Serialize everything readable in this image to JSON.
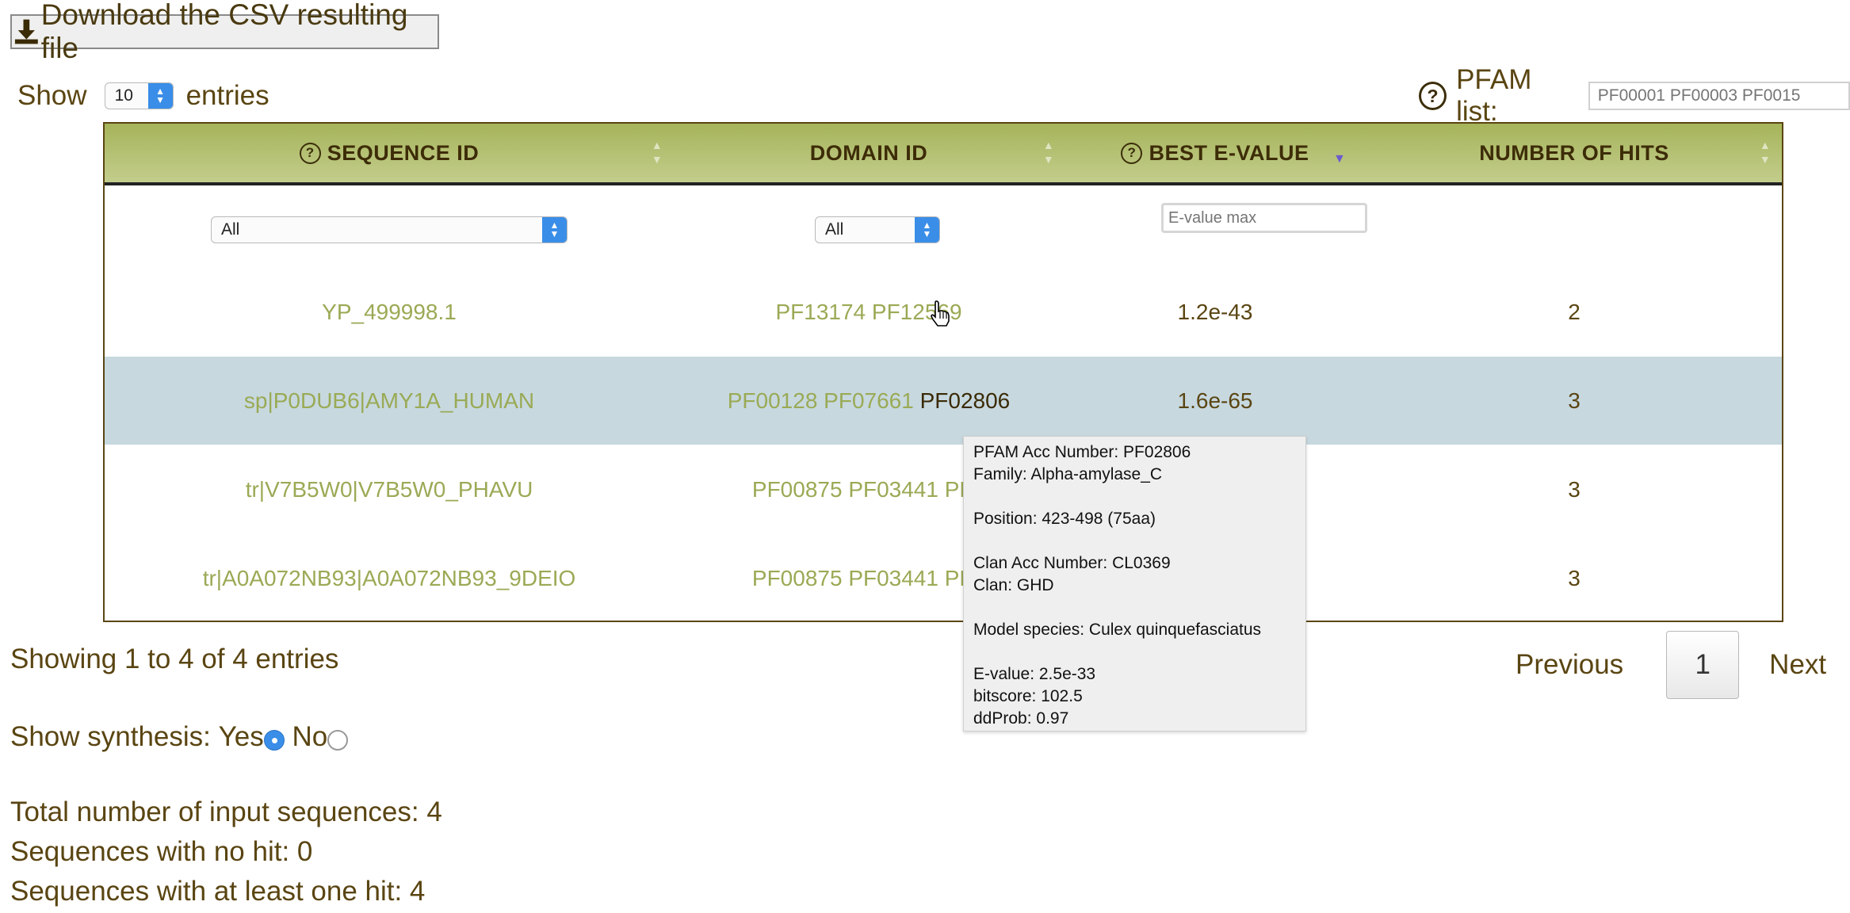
{
  "toolbar": {
    "download_label": "Download the CSV resulting file"
  },
  "length_menu": {
    "show_label": "Show",
    "value": "10",
    "entries_label": "entries"
  },
  "pfam_filter": {
    "label": "PFAM list:",
    "placeholder": "PF00001 PF00003 PF0015"
  },
  "table": {
    "columns": [
      {
        "label": "SEQUENCE ID",
        "help": "?"
      },
      {
        "label": "DOMAIN ID"
      },
      {
        "label": "BEST E-VALUE",
        "help": "?",
        "sort": "descending"
      },
      {
        "label": "NUMBER OF HITS"
      }
    ],
    "filters": {
      "sequence_select": "All",
      "domain_select": "All",
      "evalue_placeholder": "E-value max"
    },
    "rows": [
      {
        "sequence_id": "YP_499998.1",
        "domains": [
          "PF13174",
          "PF12569"
        ],
        "best_evalue": "1.2e-43",
        "hits": "2"
      },
      {
        "sequence_id": "sp|P0DUB6|AMY1A_HUMAN",
        "domains": [
          "PF00128",
          "PF07661",
          "PF02806"
        ],
        "best_evalue": "1.6e-65",
        "hits": "3"
      },
      {
        "sequence_id": "tr|V7B5W0|V7B5W0_PHAVU",
        "domains": [
          "PF00875",
          "PF03441",
          "PF1"
        ],
        "best_evalue": "",
        "hits": "3"
      },
      {
        "sequence_id": "tr|A0A072NB93|A0A072NB93_9DEIO",
        "domains": [
          "PF00875",
          "PF03441",
          "PF0"
        ],
        "best_evalue": "",
        "hits": "3"
      }
    ]
  },
  "tooltip": {
    "acc_number": "PFAM Acc Number: PF02806",
    "family": "Family: Alpha-amylase_C",
    "position": "Position: 423-498 (75aa)",
    "clan_acc": "Clan Acc Number: CL0369",
    "clan": "Clan: GHD",
    "model_species": "Model species: Culex quinquefasciatus",
    "evalue": "E-value: 2.5e-33",
    "bitscore": "bitscore: 102.5",
    "ddprob": "ddProb: 0.97"
  },
  "info": {
    "showing": "Showing 1 to 4 of 4 entries"
  },
  "pagination": {
    "previous": "Previous",
    "current_page": "1",
    "next": "Next"
  },
  "synthesis": {
    "label": "Show synthesis:",
    "yes": "Yes",
    "no": "No",
    "selected": "Yes"
  },
  "stats": {
    "total": "Total number of input sequences: 4",
    "no_hit": "Sequences with no hit: 0",
    "at_least_one": "Sequences with at least one hit: 4"
  },
  "colors": {
    "header": "#a6b45a",
    "link": "#9aaa55",
    "text": "#5a4512",
    "highlight_row": "#c7d8df",
    "accent": "#3a8ee8"
  }
}
